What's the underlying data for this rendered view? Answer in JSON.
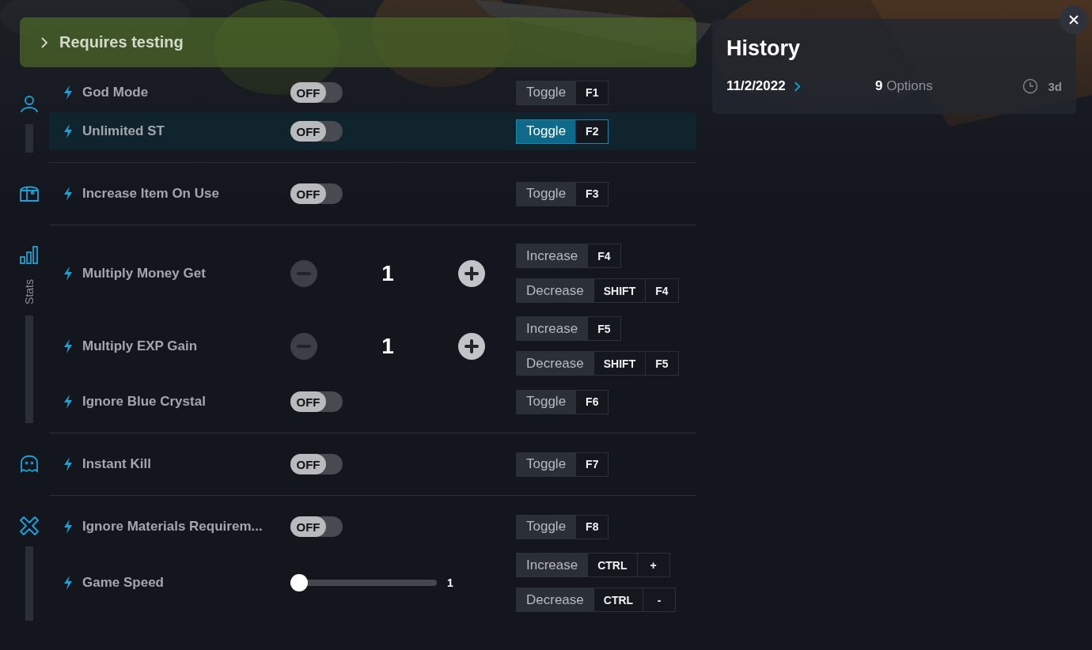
{
  "banner": {
    "label": "Requires testing",
    "expanded": false
  },
  "categories": [
    {
      "kind": "player",
      "options": [
        {
          "kind": "toggle",
          "name": "God Mode",
          "on": false,
          "state_label": "OFF",
          "selected": false,
          "hotkeys": [
            {
              "action": "Toggle",
              "keys": [
                "F1"
              ]
            }
          ]
        },
        {
          "kind": "toggle",
          "name": "Unlimited ST",
          "on": false,
          "state_label": "OFF",
          "selected": true,
          "hotkeys": [
            {
              "action": "Toggle",
              "keys": [
                "F2"
              ]
            }
          ]
        }
      ]
    },
    {
      "kind": "inventory",
      "options": [
        {
          "kind": "toggle",
          "name": "Increase Item On Use",
          "on": false,
          "state_label": "OFF",
          "selected": false,
          "hotkeys": [
            {
              "action": "Toggle",
              "keys": [
                "F3"
              ]
            }
          ]
        }
      ]
    },
    {
      "kind": "stats",
      "label": "Stats",
      "options": [
        {
          "kind": "stepper",
          "name": "Multiply Money Get",
          "value": "1",
          "selected": false,
          "hotkeys": [
            {
              "action": "Increase",
              "keys": [
                "F4"
              ]
            },
            {
              "action": "Decrease",
              "keys": [
                "SHIFT",
                "F4"
              ]
            }
          ]
        },
        {
          "kind": "stepper",
          "name": "Multiply EXP Gain",
          "value": "1",
          "selected": false,
          "hotkeys": [
            {
              "action": "Increase",
              "keys": [
                "F5"
              ]
            },
            {
              "action": "Decrease",
              "keys": [
                "SHIFT",
                "F5"
              ]
            }
          ]
        },
        {
          "kind": "toggle",
          "name": "Ignore Blue Crystal",
          "on": false,
          "state_label": "OFF",
          "selected": false,
          "hotkeys": [
            {
              "action": "Toggle",
              "keys": [
                "F6"
              ]
            }
          ]
        }
      ]
    },
    {
      "kind": "enemy",
      "options": [
        {
          "kind": "toggle",
          "name": "Instant Kill",
          "on": false,
          "state_label": "OFF",
          "selected": false,
          "hotkeys": [
            {
              "action": "Toggle",
              "keys": [
                "F7"
              ]
            }
          ]
        }
      ]
    },
    {
      "kind": "crafting",
      "options": [
        {
          "kind": "toggle",
          "name": "Ignore Materials Requirem...",
          "on": false,
          "state_label": "OFF",
          "selected": false,
          "hotkeys": [
            {
              "action": "Toggle",
              "keys": [
                "F8"
              ]
            }
          ]
        },
        {
          "kind": "slider",
          "name": "Game Speed",
          "level": 0,
          "reading": "1",
          "selected": false,
          "hotkeys": [
            {
              "action": "Increase",
              "keys": [
                "CTRL",
                "+"
              ]
            },
            {
              "action": "Decrease",
              "keys": [
                "CTRL",
                "-"
              ]
            }
          ]
        }
      ]
    }
  ],
  "history": {
    "title": "History",
    "date": "11/2/2022",
    "count": "9",
    "count_label": "Options",
    "age": "3d"
  }
}
